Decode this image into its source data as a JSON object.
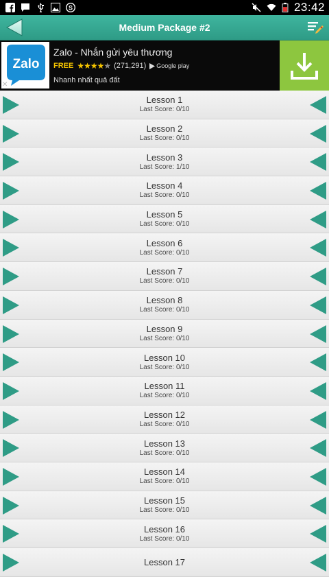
{
  "status_bar": {
    "time": "23:42",
    "left_icons": [
      "facebook-icon",
      "message-icon",
      "usb-icon",
      "image-icon",
      "skype-icon"
    ],
    "right_icons": [
      "mute-icon",
      "wifi-icon",
      "battery-icon"
    ]
  },
  "action_bar": {
    "title": "Medium Package #2",
    "color": "#35a892"
  },
  "ad": {
    "logo_text": "Zalo",
    "title": "Zalo - Nhắn gửi yêu thương",
    "free_label": "FREE",
    "rating_stars": 4,
    "rating_count": "(271,291)",
    "store_label": "Google play",
    "tagline": "Nhanh nhất quả đất",
    "close_label": "✕",
    "download_color": "#8dc63f"
  },
  "lessons": [
    {
      "name": "Lesson 1",
      "score": "Last Score: 0/10"
    },
    {
      "name": "Lesson 2",
      "score": "Last Score: 0/10"
    },
    {
      "name": "Lesson 3",
      "score": "Last Score: 1/10"
    },
    {
      "name": "Lesson 4",
      "score": "Last Score: 0/10"
    },
    {
      "name": "Lesson 5",
      "score": "Last Score: 0/10"
    },
    {
      "name": "Lesson 6",
      "score": "Last Score: 0/10"
    },
    {
      "name": "Lesson 7",
      "score": "Last Score: 0/10"
    },
    {
      "name": "Lesson 8",
      "score": "Last Score: 0/10"
    },
    {
      "name": "Lesson 9",
      "score": "Last Score: 0/10"
    },
    {
      "name": "Lesson 10",
      "score": "Last Score: 0/10"
    },
    {
      "name": "Lesson 11",
      "score": "Last Score: 0/10"
    },
    {
      "name": "Lesson 12",
      "score": "Last Score: 0/10"
    },
    {
      "name": "Lesson 13",
      "score": "Last Score: 0/10"
    },
    {
      "name": "Lesson 14",
      "score": "Last Score: 0/10"
    },
    {
      "name": "Lesson 15",
      "score": "Last Score: 0/10"
    },
    {
      "name": "Lesson 16",
      "score": "Last Score: 0/10"
    },
    {
      "name": "Lesson 17",
      "score": ""
    }
  ],
  "colors": {
    "accent": "#35a892",
    "play_arrow": "#2f9c86"
  }
}
